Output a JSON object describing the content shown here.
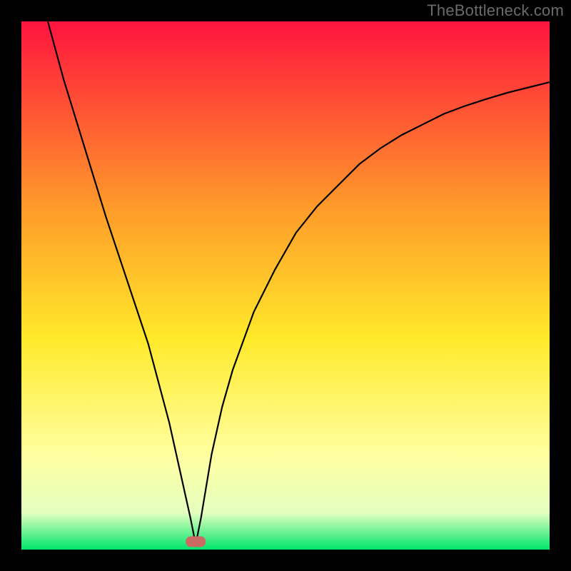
{
  "watermark": "TheBottleneck.com",
  "chart_data": {
    "type": "line",
    "title": "",
    "xlabel": "",
    "ylabel": "",
    "xlim": [
      0,
      100
    ],
    "ylim": [
      0,
      100
    ],
    "grid": false,
    "legend": false,
    "background_gradient": {
      "top": "#ff143e",
      "mid1": "#ff9a2a",
      "mid2": "#ffe92a",
      "mid3": "#ffffa0",
      "mid4": "#e5ffc0",
      "bottom": "#00e66d"
    },
    "marker": {
      "x": 33,
      "y": 1.5,
      "color": "#c96b63"
    },
    "series": [
      {
        "name": "curve",
        "x": [
          5,
          8,
          12,
          16,
          20,
          24,
          28,
          30,
          32,
          33,
          34,
          36,
          38,
          40,
          44,
          48,
          52,
          56,
          60,
          64,
          68,
          72,
          76,
          80,
          84,
          88,
          92,
          96,
          100
        ],
        "y": [
          100,
          89,
          76,
          63,
          51,
          39,
          24,
          15,
          6,
          1,
          6,
          18,
          27,
          34,
          45,
          53,
          60,
          65,
          69,
          73,
          76,
          78.5,
          80.5,
          82.5,
          84,
          85.3,
          86.5,
          87.5,
          88.5
        ]
      }
    ]
  }
}
